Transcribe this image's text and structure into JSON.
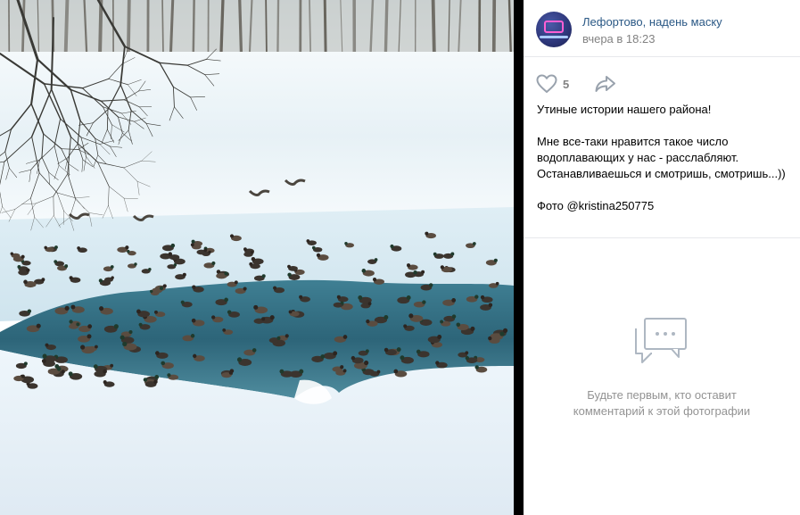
{
  "post": {
    "author": "Лефортово, надень маску",
    "time": "вчера в 18:23",
    "avatar_icon": "community-logo-icon",
    "likes": "5",
    "caption": {
      "line1": "Утиные истории нашего района!",
      "line2": "Мне все-таки нравится такое число водоплавающих у нас - расслабляют. Останавливаешься и смотришь, смотришь...))",
      "line3": "Фото @kristina250775"
    }
  },
  "comments": {
    "empty_line1": "Будьте первым, кто оставит",
    "empty_line2": "комментарий к этой фотографии"
  },
  "colors": {
    "link": "#2a5885",
    "muted": "#828282",
    "icon": "#99a2ad",
    "empty_icon": "#aeb7c2"
  }
}
